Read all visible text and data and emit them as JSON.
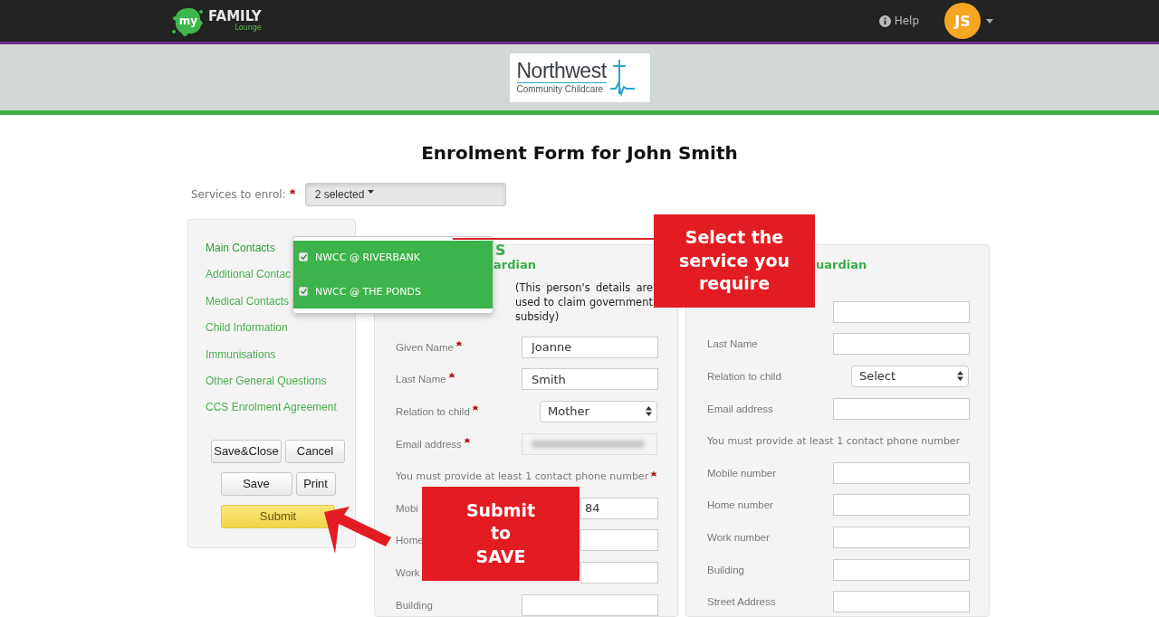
{
  "topbar": {
    "logo_my": "my",
    "logo_family": "FAMILY",
    "logo_lounge": "Lounge",
    "help": "Help",
    "avatar_initials": "JS"
  },
  "banner": {
    "logo_title": "Northwest",
    "logo_subtitle": "Community Childcare"
  },
  "title": "Enrolment Form for John Smith",
  "services": {
    "label": "Services to enrol:",
    "required": true,
    "button": "2 selected",
    "expanded": true,
    "options": [
      {
        "label": "NWCC @ RIVERBANK",
        "checked": true
      },
      {
        "label": "NWCC @ THE PONDS",
        "checked": true
      }
    ]
  },
  "section_heading_fragment": "S",
  "sidebar": {
    "items": [
      {
        "label": "Main Contacts",
        "selected": true
      },
      {
        "label": "Additional Contac",
        "selected": false
      },
      {
        "label": "Medical Contacts",
        "selected": false
      },
      {
        "label": "Child Information",
        "selected": false
      },
      {
        "label": "Immunisations",
        "selected": false
      },
      {
        "label": "Other General Questions",
        "selected": false
      },
      {
        "label": "CCS Enrolment Agreement",
        "selected": false
      }
    ],
    "buttons": [
      {
        "label": "Save&Close",
        "kind": "default"
      },
      {
        "label": "Cancel",
        "kind": "default"
      },
      {
        "label": "Save",
        "kind": "default"
      },
      {
        "label": "Print",
        "kind": "default"
      },
      {
        "label": "Submit",
        "kind": "primary"
      }
    ]
  },
  "panels": [
    {
      "heading": "ardian",
      "note": "(This person's details are used to claim government subsidy)",
      "fields": [
        {
          "kind": "text",
          "label": "Given Name",
          "required": true,
          "value": "Joanne"
        },
        {
          "kind": "text",
          "label": "Last Name",
          "required": true,
          "value": "Smith"
        },
        {
          "kind": "select",
          "label": "Relation to child",
          "required": true,
          "value": "Mother"
        },
        {
          "kind": "redacted",
          "label": "Email address",
          "required": true
        },
        {
          "kind": "notice",
          "label": "You must provide at least 1 contact phone number",
          "required": true
        },
        {
          "kind": "text",
          "label": "Mobi",
          "required": false,
          "value": "84",
          "partial": true
        },
        {
          "kind": "text",
          "label": "Home",
          "required": false,
          "partial": true
        },
        {
          "kind": "text",
          "label": "Work",
          "required": false,
          "partial": true
        },
        {
          "kind": "text",
          "label": "Building",
          "required": false
        }
      ]
    },
    {
      "heading": "uardian",
      "fields": [
        {
          "kind": "text",
          "required": false
        },
        {
          "kind": "text",
          "label": "Last Name",
          "required": false
        },
        {
          "kind": "select",
          "label": "Relation to child",
          "required": false,
          "value": "Select"
        },
        {
          "kind": "text",
          "label": "Email address",
          "required": false
        },
        {
          "kind": "notice",
          "label": "You must provide at least 1 contact phone number",
          "required": false
        },
        {
          "kind": "text",
          "label": "Mobile number",
          "required": false
        },
        {
          "kind": "text",
          "label": "Home number",
          "required": false
        },
        {
          "kind": "text",
          "label": "Work number",
          "required": false
        },
        {
          "kind": "text",
          "label": "Building",
          "required": false
        },
        {
          "kind": "text",
          "label": "Street Address",
          "required": false
        }
      ]
    }
  ],
  "callouts": [
    {
      "text": "Select the service you require"
    },
    {
      "text": "Submit to SAVE"
    }
  ]
}
